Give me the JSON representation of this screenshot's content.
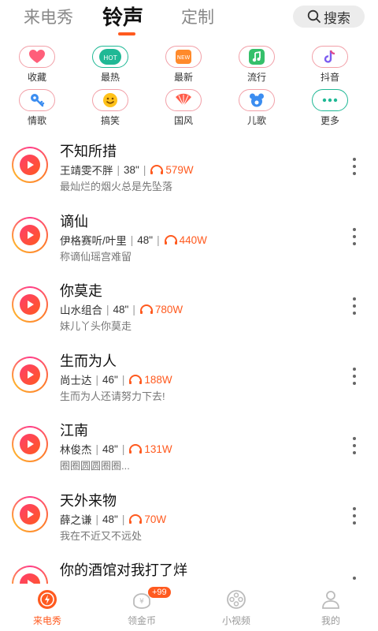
{
  "top_tabs": [
    {
      "label": "来电秀"
    },
    {
      "label": "铃声"
    },
    {
      "label": "定制"
    }
  ],
  "search": {
    "label": "搜索",
    "icon": "search-icon"
  },
  "categories": [
    {
      "label": "收藏",
      "icon": "heart-icon",
      "color": "#ff5f7a"
    },
    {
      "label": "最热",
      "icon": "hot-badge-icon",
      "color": "#1fb895"
    },
    {
      "label": "最新",
      "icon": "new-badge-icon",
      "color": "#ff8a2b"
    },
    {
      "label": "流行",
      "icon": "music-note-icon",
      "color": "#35c06a"
    },
    {
      "label": "抖音",
      "icon": "tiktok-icon",
      "color": "#b97cf0"
    },
    {
      "label": "情歌",
      "icon": "key-icon",
      "color": "#3b8df0"
    },
    {
      "label": "搞笑",
      "icon": "smile-icon",
      "color": "#ffc21a"
    },
    {
      "label": "国风",
      "icon": "fan-icon",
      "color": "#ff5d4a"
    },
    {
      "label": "儿歌",
      "icon": "bear-icon",
      "color": "#3b8df0"
    },
    {
      "label": "更多",
      "icon": "more-dots-icon",
      "color": "#1fb895"
    }
  ],
  "songs": [
    {
      "title": "不知所措",
      "artist": "王靖雯不胖",
      "duration": "38\"",
      "plays": "579W",
      "lyric": "最灿烂的烟火总是先坠落"
    },
    {
      "title": "谪仙",
      "artist": "伊格赛听/叶里",
      "duration": "48\"",
      "plays": "440W",
      "lyric": "称谪仙瑶宫难留"
    },
    {
      "title": "你莫走",
      "artist": "山水组合",
      "duration": "48\"",
      "plays": "780W",
      "lyric": "妹儿丫头你莫走"
    },
    {
      "title": "生而为人",
      "artist": "尚士达",
      "duration": "46\"",
      "plays": "188W",
      "lyric": "生而为人还请努力下去!"
    },
    {
      "title": "江南",
      "artist": "林俊杰",
      "duration": "48\"",
      "plays": "131W",
      "lyric": "圈圈圆圆圈圈..."
    },
    {
      "title": "天外来物",
      "artist": "薛之谦",
      "duration": "48\"",
      "plays": "70W",
      "lyric": "我在不近又不远处"
    },
    {
      "title": "你的酒馆对我打了烊",
      "artist": "",
      "duration": "",
      "plays": "",
      "lyric": ""
    }
  ],
  "bottom_nav": [
    {
      "label": "来电秀",
      "icon": "call-show-icon",
      "active": true
    },
    {
      "label": "领金币",
      "icon": "coin-icon",
      "badge": "+99"
    },
    {
      "label": "小视频",
      "icon": "film-reel-icon"
    },
    {
      "label": "我的",
      "icon": "user-icon"
    }
  ],
  "colors": {
    "accent": "#ff5a1f",
    "play_gradient": [
      "#ff3d8b",
      "#ff7a2e"
    ]
  }
}
